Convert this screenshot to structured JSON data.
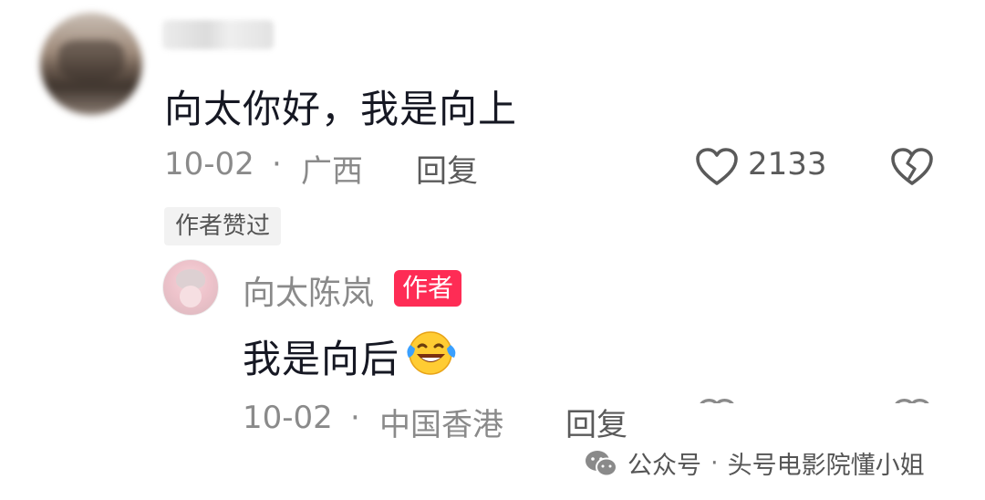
{
  "comment": {
    "text": "向太你好，我是向上",
    "date": "10-02",
    "location": "广西",
    "dot": "·",
    "reply_label": "回复",
    "like_count": "2133",
    "author_liked": "作者赞过"
  },
  "reply": {
    "username": "向太陈岚",
    "badge": "作者",
    "text": "我是向后",
    "date": "10-02",
    "location": "中国香港",
    "dot": "·",
    "reply_label": "回复"
  },
  "watermark": {
    "account_type": "公众号",
    "sep": "·",
    "account_name": "头号电影院懂小姐"
  },
  "colors": {
    "badge_red": "#fe2c55",
    "meta_gray": "#8a8a8a",
    "text_dark": "#161823"
  },
  "icons": [
    "like-heart-icon",
    "dislike-broken-heart-icon",
    "laughing-crying-emoji-icon",
    "wechat-logo-icon"
  ]
}
